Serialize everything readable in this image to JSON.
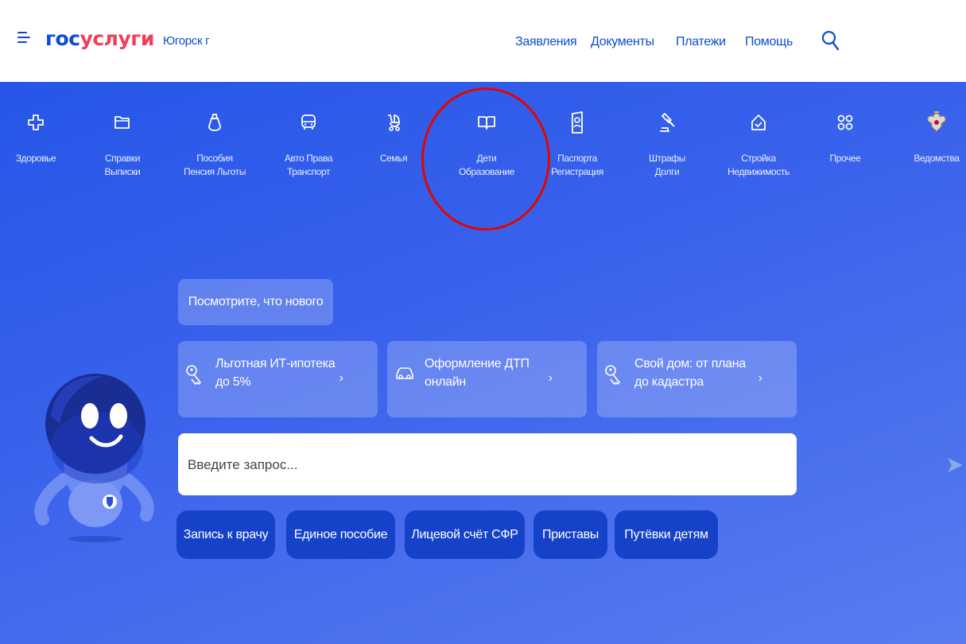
{
  "header": {
    "logo_part1": "гос",
    "logo_part2": "услуги",
    "city": "Югорск г",
    "nav": [
      "Заявления",
      "Документы",
      "Платежи",
      "Помощь"
    ],
    "icons": {
      "menu": "burger-menu-icon",
      "search": "search-icon"
    }
  },
  "categories": [
    {
      "line1": "Здоровье",
      "line2": "",
      "icon": "cross-icon"
    },
    {
      "line1": "Справки",
      "line2": "Выписки",
      "icon": "folder-icon"
    },
    {
      "line1": "Пособия",
      "line2": "Пенсия Льготы",
      "icon": "bag-icon"
    },
    {
      "line1": "Авто Права",
      "line2": "Транспорт",
      "icon": "bus-icon"
    },
    {
      "line1": "Семья",
      "line2": "",
      "icon": "stroller-icon"
    },
    {
      "line1": "Дети",
      "line2": "Образование",
      "icon": "book-icon"
    },
    {
      "line1": "Паспорта",
      "line2": "Регистрация",
      "icon": "passport-icon"
    },
    {
      "line1": "Штрафы",
      "line2": "Долги",
      "icon": "gavel-icon"
    },
    {
      "line1": "Стройка",
      "line2": "Недвижимость",
      "icon": "house-icon"
    },
    {
      "line1": "Прочее",
      "line2": "",
      "icon": "grid-icon"
    },
    {
      "line1": "Ведомства",
      "line2": "",
      "icon": "emblem-icon"
    }
  ],
  "highlight": "Дети Образование",
  "whats_new": "Посмотрите, что нового",
  "promos": [
    {
      "line1": "Льготная ИТ-ипотека",
      "line2": "до 5%",
      "icon": "key-icon"
    },
    {
      "line1": "Оформление ДТП",
      "line2": "онлайн",
      "icon": "car-icon"
    },
    {
      "line1": "Свой дом: от плана",
      "line2": "до кадастра",
      "icon": "key-icon"
    }
  ],
  "chevron": "›",
  "search": {
    "placeholder": "Введите запрос...",
    "icon": "send-arrow-icon"
  },
  "chips": [
    "Запись к врачу",
    "Единое пособие",
    "Лицевой счёт СФР",
    "Приставы",
    "Путёвки детям"
  ],
  "colors": {
    "brand_blue": "#0d4cd3",
    "brand_red": "#ee3f58",
    "hero_blue": "#2e5bea",
    "chip_blue": "#1542c9",
    "highlight_red": "#e10600"
  }
}
